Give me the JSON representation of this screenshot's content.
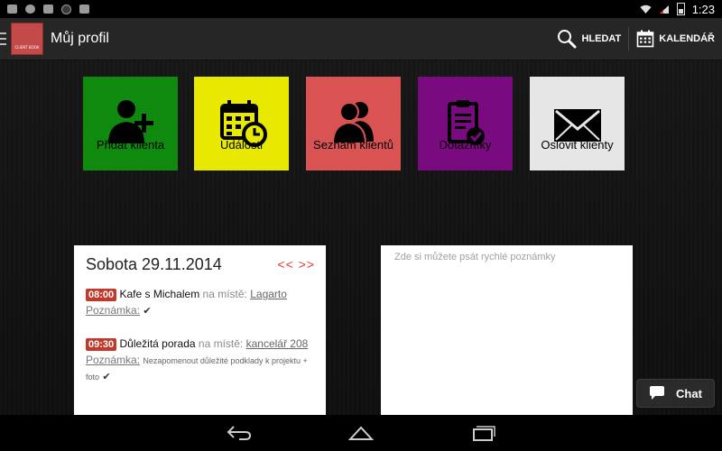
{
  "status_bar": {
    "time": "1:23",
    "icons": [
      "image-icon",
      "cloud-icon",
      "bag-icon",
      "badge-icon",
      "bag-icon",
      "wifi-icon",
      "signal-icon",
      "battery-icon"
    ]
  },
  "action_bar": {
    "title": "Můj profil",
    "logo_text": "CLIENT BOOK",
    "search_label": "HLEDAT",
    "calendar_label": "KALENDÁŘ"
  },
  "tiles": [
    {
      "label": "Přidat klienta",
      "color": "#0f8a0f",
      "icon": "add-user-icon"
    },
    {
      "label": "Události",
      "color": "#e8e800",
      "icon": "calendar-clock-icon"
    },
    {
      "label": "Seznam klientů",
      "color": "#d95353",
      "icon": "users-icon"
    },
    {
      "label": "Dotazníky",
      "color": "#7a0a80",
      "icon": "clipboard-check-icon"
    },
    {
      "label": "Oslovit klienty",
      "color": "#e6e6e6",
      "icon": "envelope-icon"
    }
  ],
  "agenda": {
    "date": "Sobota 29.11.2014",
    "nav_prev": "<<",
    "nav_next": ">>",
    "events": [
      {
        "time": "08:00",
        "title": "Kafe s Michalem",
        "place_label": "na místě:",
        "place": "Lagarto",
        "note_label": "Poznámka:",
        "note": ""
      },
      {
        "time": "09:30",
        "title": "Důležitá porada",
        "place_label": "na místě:",
        "place": "kancelář 208",
        "note_label": "Poznámka:",
        "note": "Nezapomenout důležité podklady k projektu + foto"
      }
    ]
  },
  "notes": {
    "placeholder": "Zde si můžete psát rychlé poznámky",
    "value": ""
  },
  "chat": {
    "label": "Chat"
  },
  "nav_bar": {
    "buttons": [
      "back",
      "home",
      "recent-apps"
    ]
  }
}
